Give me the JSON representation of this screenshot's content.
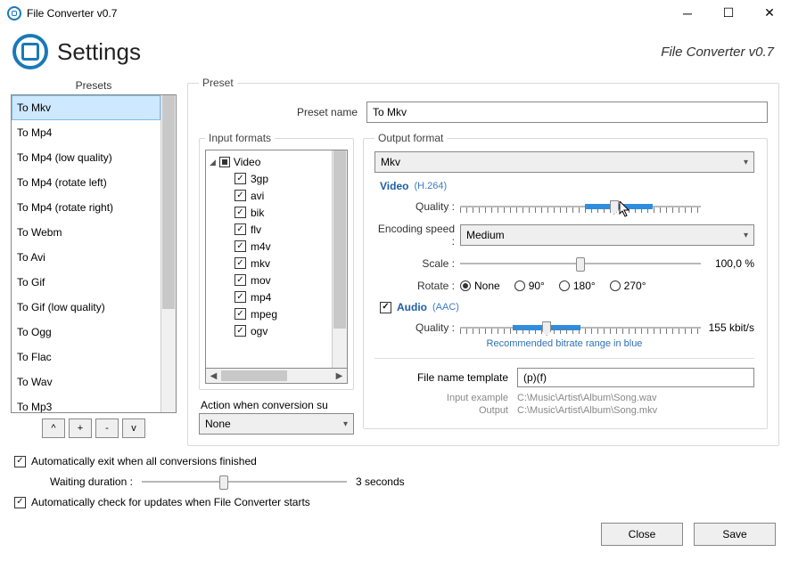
{
  "titlebar": {
    "title": "File Converter v0.7"
  },
  "header": {
    "title": "Settings",
    "brand": "File Converter v0.7"
  },
  "presets": {
    "heading": "Presets",
    "items": [
      "To Mkv",
      "To Mp4",
      "To Mp4 (low quality)",
      "To Mp4 (rotate left)",
      "To Mp4 (rotate right)",
      "To Webm",
      "To Avi",
      "To Gif",
      "To Gif (low quality)",
      "To Ogg",
      "To Flac",
      "To Wav",
      "To Mp3"
    ],
    "selected_index": 0,
    "btn_up": "^",
    "btn_add": "+",
    "btn_del": "-",
    "btn_down": "v"
  },
  "preset_panel": {
    "legend": "Preset",
    "name_label": "Preset name",
    "name_value": "To Mkv"
  },
  "input_formats": {
    "legend": "Input formats",
    "group": "Video",
    "items": [
      "3gp",
      "avi",
      "bik",
      "flv",
      "m4v",
      "mkv",
      "mov",
      "mp4",
      "mpeg",
      "ogv"
    ],
    "action_label": "Action when conversion su",
    "action_value": "None"
  },
  "output": {
    "legend": "Output format",
    "format": "Mkv",
    "video_label": "Video",
    "video_codec": "(H.264)",
    "quality_label": "Quality :",
    "enc_label": "Encoding speed :",
    "enc_value": "Medium",
    "scale_label": "Scale :",
    "scale_value": "100,0 %",
    "rotate_label": "Rotate :",
    "rotate_options": [
      "None",
      "90°",
      "180°",
      "270°"
    ],
    "rotate_selected": 0,
    "audio_label": "Audio",
    "audio_codec": "(AAC)",
    "audio_quality_label": "Quality :",
    "audio_value": "155 kbit/s",
    "reco": "Recommended bitrate range in blue",
    "template_label": "File name template",
    "template_value": "(p)(f)",
    "example_in_label": "Input example",
    "example_in": "C:\\Music\\Artist\\Album\\Song.wav",
    "example_out_label": "Output",
    "example_out": "C:\\Music\\Artist\\Album\\Song.mkv"
  },
  "footer": {
    "auto_exit": "Automatically exit when all conversions finished",
    "wait_label": "Waiting duration :",
    "wait_value": "3 seconds",
    "auto_check": "Automatically check for updates when File Converter starts",
    "close": "Close",
    "save": "Save"
  }
}
